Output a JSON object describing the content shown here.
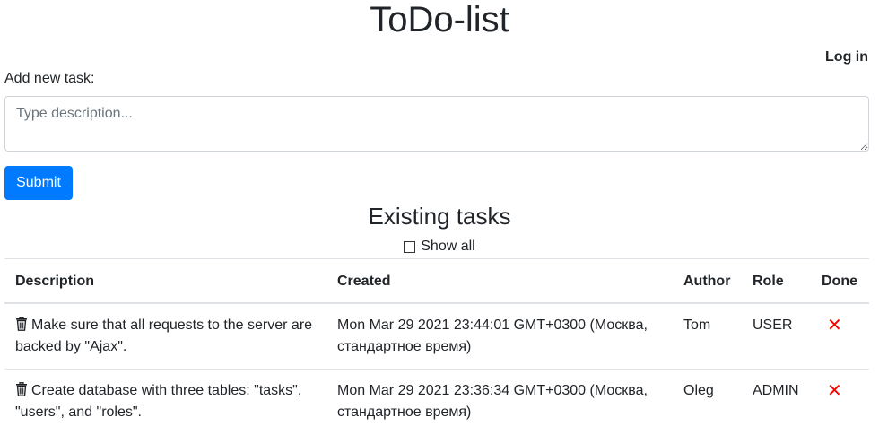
{
  "header": {
    "title": "ToDo-list",
    "login_label": "Log in"
  },
  "form": {
    "label": "Add new task:",
    "placeholder": "Type description...",
    "submit_label": "Submit"
  },
  "tasks_section": {
    "title": "Existing tasks",
    "show_all_label": "Show all"
  },
  "table": {
    "headers": {
      "description": "Description",
      "created": "Created",
      "author": "Author",
      "role": "Role",
      "done": "Done"
    },
    "rows": [
      {
        "description": "Make sure that all requests to the server are backed by \"Ajax\".",
        "created": "Mon Mar 29 2021 23:44:01 GMT+0300 (Москва, стандартное время)",
        "author": "Tom",
        "role": "USER",
        "done_icon": "✕"
      },
      {
        "description": "Create database with three tables: \"tasks\", \"users\", and \"roles\".",
        "created": "Mon Mar 29 2021 23:36:34 GMT+0300 (Москва, стандартное время)",
        "author": "Oleg",
        "role": "ADMIN",
        "done_icon": "✕"
      }
    ]
  },
  "colors": {
    "primary": "#007bff",
    "danger": "#ff0000"
  },
  "icons": {
    "delete": "trash-icon",
    "not_done": "x-icon"
  }
}
